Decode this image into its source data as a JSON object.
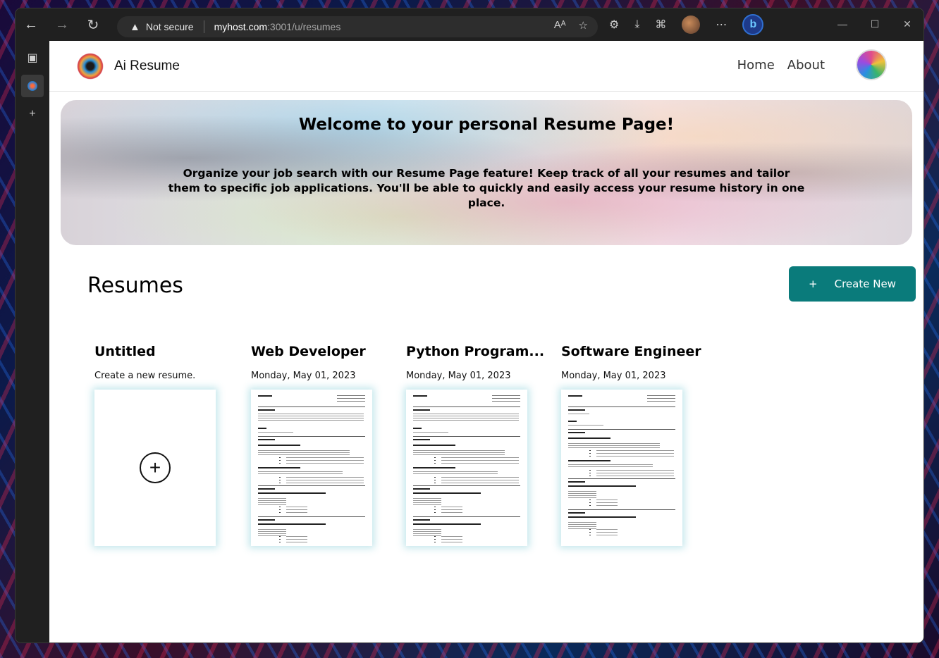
{
  "browser": {
    "not_secure_label": "Not secure",
    "url_host": "myhost.com",
    "url_rest": ":3001/u/resumes"
  },
  "header": {
    "brand": "Ai Resume",
    "nav": [
      "Home",
      "About"
    ]
  },
  "hero": {
    "title": "Welcome to your personal Resume Page!",
    "text": "Organize your job search with our Resume Page feature! Keep track of all your resumes and tailor them to specific job applications. You'll be able to quickly and easily access your resume history in one place."
  },
  "resumes": {
    "title": "Resumes",
    "create_label": "Create New",
    "cards": [
      {
        "title": "Untitled",
        "subtitle": "Create a new resume."
      },
      {
        "title": "Web Developer",
        "subtitle": "Monday, May 01, 2023"
      },
      {
        "title": "Python Program...",
        "subtitle": "Monday, May 01, 2023"
      },
      {
        "title": "Software Engineer",
        "subtitle": "Monday, May 01, 2023"
      }
    ]
  },
  "colors": {
    "accent": "#0a7b7b",
    "thumb_glow": "#78c8d2"
  },
  "icons": {
    "back": "arrow-left-icon",
    "forward": "arrow-right-icon",
    "refresh": "refresh-icon",
    "warning": "warning-icon",
    "add_resume": "plus-circle-icon"
  }
}
